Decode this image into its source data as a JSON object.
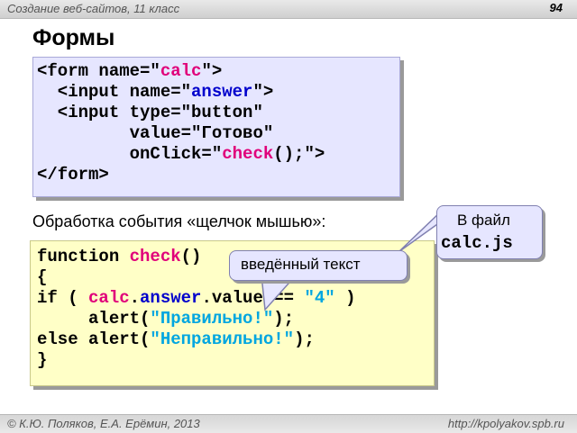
{
  "header": {
    "course": "Создание веб-сайтов, 11 класс",
    "page_number": "94"
  },
  "title": "Формы",
  "form_code": {
    "l1_a": "<form name=\"",
    "l1_b": "calc",
    "l1_c": "\">",
    "l2_a": "  <input name=\"",
    "l2_b": "answer",
    "l2_c": "\">",
    "l3": "  <input type=\"button\"",
    "l4": "         value=\"Готово\"",
    "l5_a": "         onClick=\"",
    "l5_b": "check",
    "l5_c": "();\">",
    "l6": "</form>"
  },
  "event_label": "Обработка события «щелчок мышью»:",
  "callout_file": {
    "line1": "В файл",
    "line2": "calc.js"
  },
  "callout_input": "введённый текст",
  "js_code": {
    "l1_a": "function ",
    "l1_b": "check",
    "l1_c": "()",
    "l2": "{",
    "l3_a": "if ( ",
    "l3_b": "calc",
    "l3_c": ".",
    "l3_d": "answer",
    "l3_e": ".value == ",
    "l3_f": "\"4\"",
    "l3_g": " )",
    "l4_a": "     alert(",
    "l4_b": "\"Правильно!\"",
    "l4_c": ");",
    "l5_a": "else alert(",
    "l5_b": "\"Неправильно!\"",
    "l5_c": ");",
    "l6": "}"
  },
  "footer": {
    "authors": "© К.Ю. Поляков, Е.А. Ерёмин, 2013",
    "url": "http://kpolyakov.spb.ru"
  },
  "colors": {
    "keyword": "#e0007a",
    "identifier": "#0000cc",
    "string": "#00a6e0",
    "form_box": "#e6e6ff",
    "code_box": "#ffffc7"
  }
}
